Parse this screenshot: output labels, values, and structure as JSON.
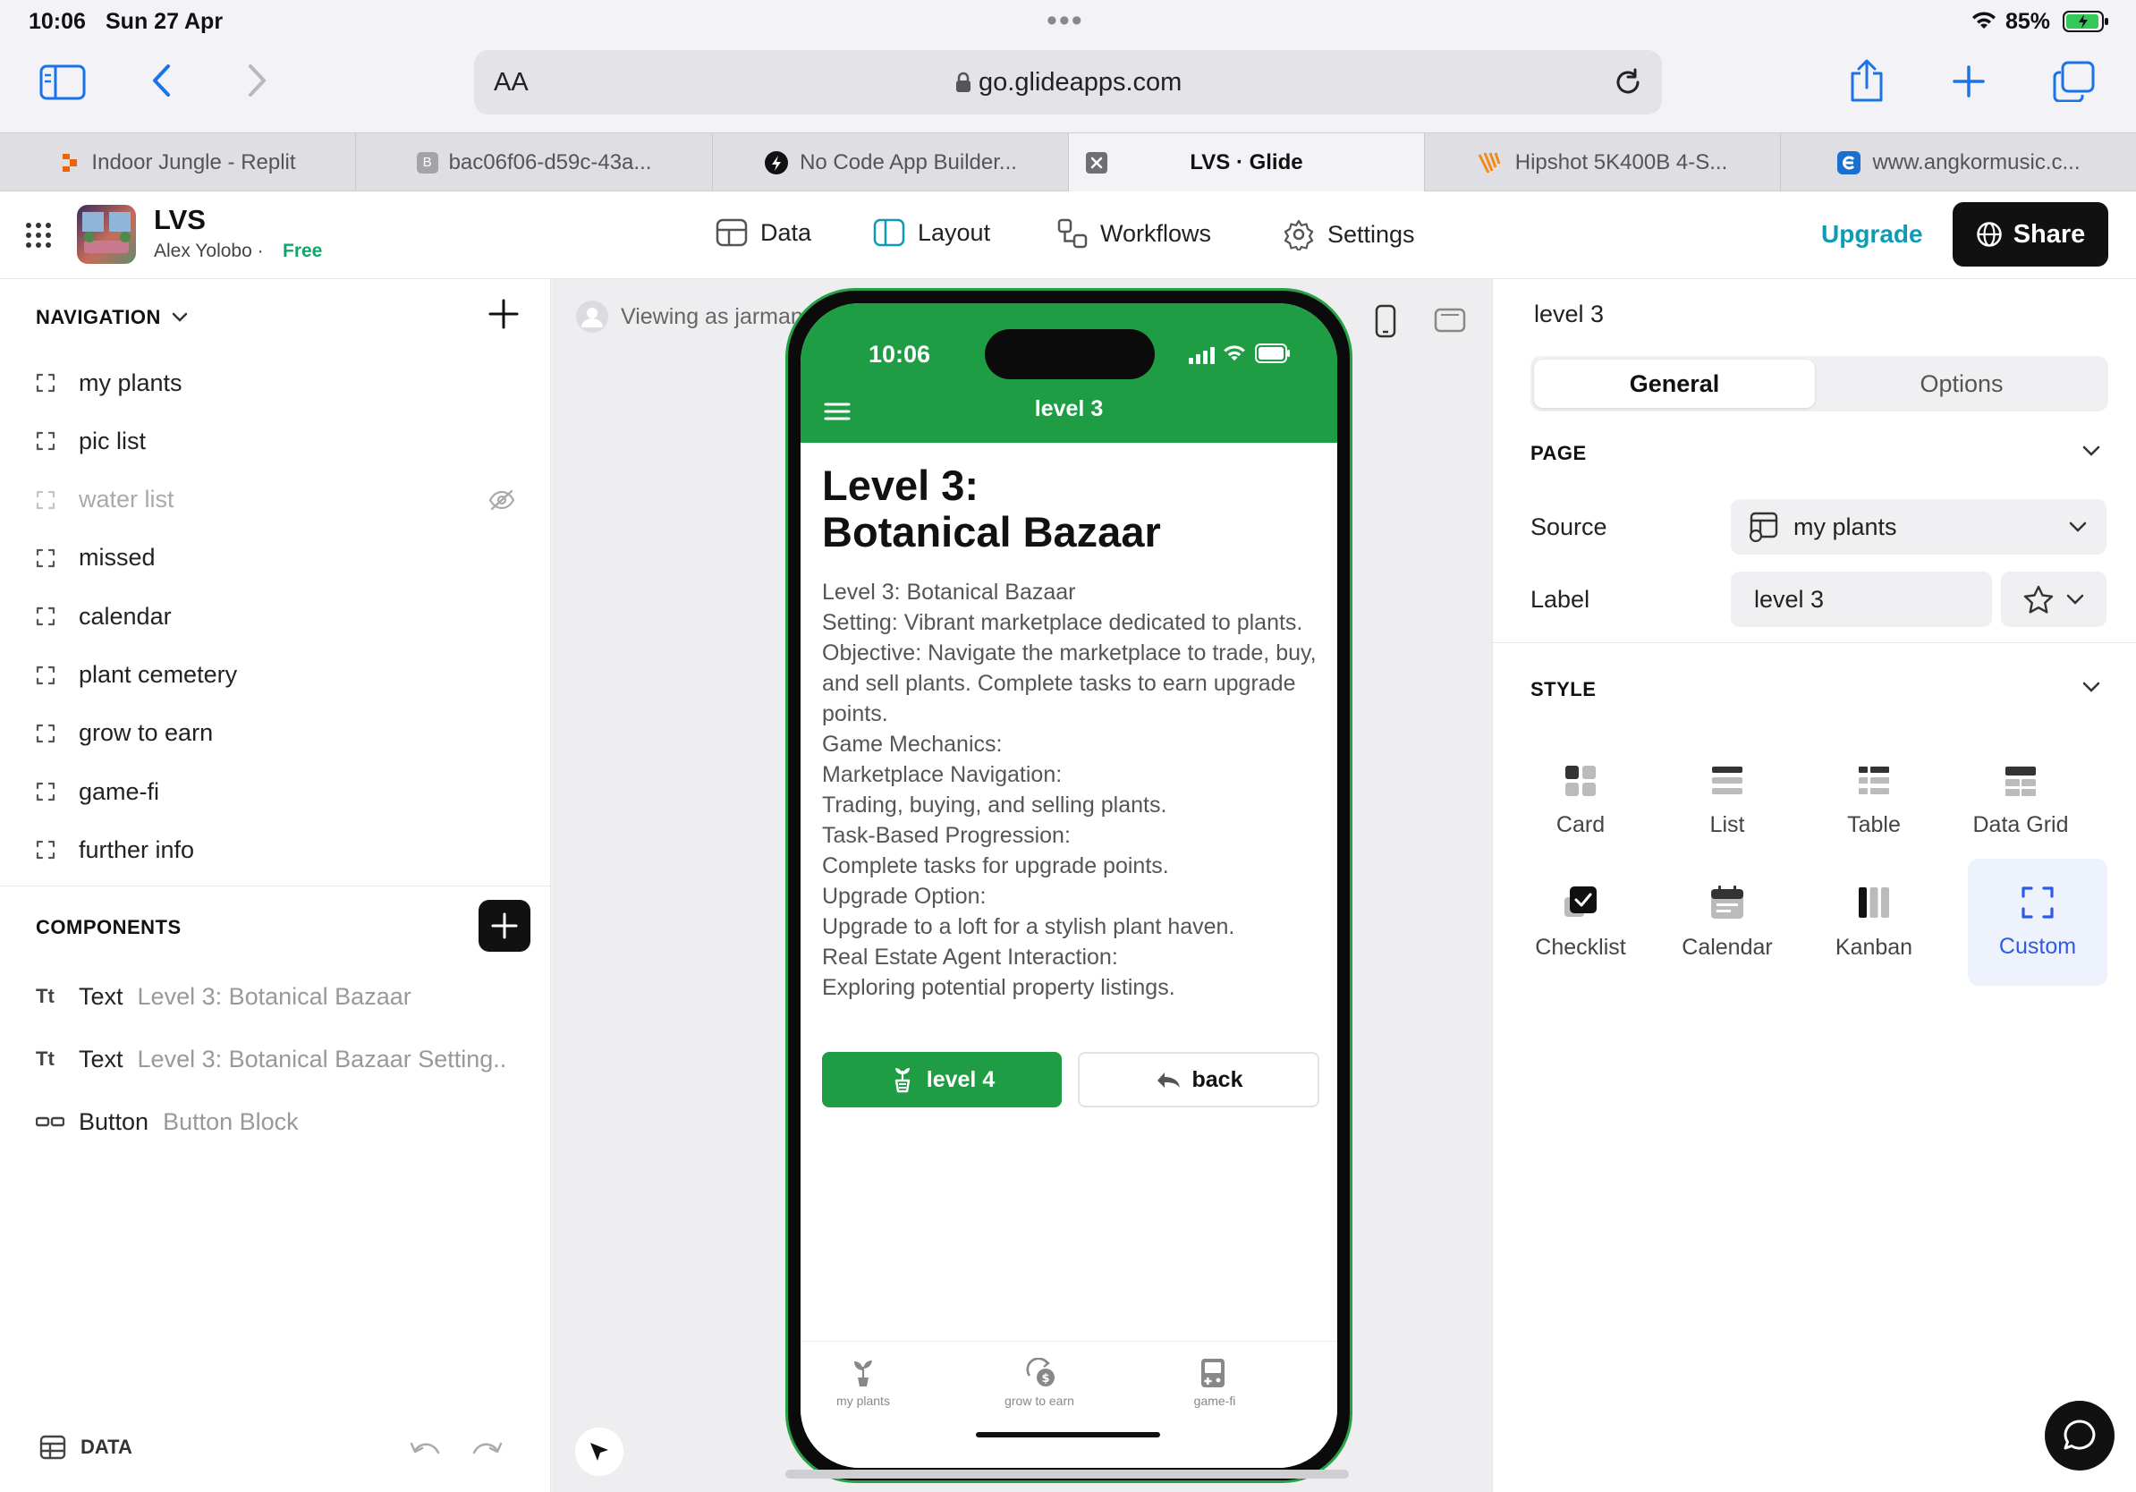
{
  "status_bar": {
    "time": "10:06",
    "date": "Sun 27 Apr",
    "battery": "85%"
  },
  "browser": {
    "url": "go.glideapps.com",
    "aa_label": "AA",
    "tabs": [
      {
        "label": "Indoor Jungle - Replit",
        "active": false
      },
      {
        "label": "bac06f06-d59c-43a...",
        "active": false
      },
      {
        "label": "No Code App Builder...",
        "active": false
      },
      {
        "label": "LVS · Glide",
        "active": true
      },
      {
        "label": "Hipshot 5K400B 4-S...",
        "active": false
      },
      {
        "label": "www.angkormusic.c...",
        "active": false
      }
    ]
  },
  "app_header": {
    "title": "LVS",
    "owner": "Alex Yolobo",
    "separator": "·",
    "plan": "Free",
    "tabs": [
      {
        "label": "Data",
        "icon": "table-icon"
      },
      {
        "label": "Layout",
        "icon": "layout-icon"
      },
      {
        "label": "Workflows",
        "icon": "workflow-icon"
      },
      {
        "label": "Settings",
        "icon": "gear-icon"
      }
    ],
    "upgrade_label": "Upgrade",
    "share_label": "Share"
  },
  "left_panel": {
    "navigation_title": "NAVIGATION",
    "nav_items": [
      {
        "label": "my plants",
        "hidden": false
      },
      {
        "label": "pic list",
        "hidden": false
      },
      {
        "label": "water list",
        "hidden": true
      },
      {
        "label": "missed",
        "hidden": false
      },
      {
        "label": "calendar",
        "hidden": false
      },
      {
        "label": "plant cemetery",
        "hidden": false
      },
      {
        "label": "grow to earn",
        "hidden": false
      },
      {
        "label": "game-fi",
        "hidden": false
      },
      {
        "label": "further info",
        "hidden": false
      }
    ],
    "components_title": "COMPONENTS",
    "components": [
      {
        "type_icon": "Tt",
        "name": "Text",
        "value": "Level 3: Botanical Bazaar"
      },
      {
        "type_icon": "Tt",
        "name": "Text",
        "value": "Level 3: Botanical Bazaar Setting.."
      },
      {
        "type_icon": "button-block-icon",
        "name": "Button",
        "value": "Button Block"
      }
    ],
    "footer_label": "DATA"
  },
  "canvas": {
    "viewing_as": "Viewing as jarmans"
  },
  "phone": {
    "time": "10:06",
    "screen_title": "level 3",
    "heading": "Level 3:\nBotanical Bazaar",
    "body_lines": [
      "Level 3: Botanical Bazaar",
      "Setting: Vibrant marketplace dedicated to plants.",
      "Objective: Navigate the marketplace to trade, buy, and sell plants. Complete tasks to earn upgrade points.",
      "Game Mechanics:",
      "Marketplace Navigation:",
      "Trading, buying, and selling plants.",
      "Task-Based Progression:",
      "Complete tasks for upgrade points.",
      "Upgrade Option:",
      "Upgrade to a loft for a stylish plant haven.",
      "Real Estate Agent Interaction:",
      "Exploring potential property listings."
    ],
    "btn_primary": "level 4",
    "btn_secondary": "back",
    "tab_bar": [
      {
        "label": "my plants",
        "icon": "plant-icon"
      },
      {
        "label": "grow to earn",
        "icon": "recycle-money-icon"
      },
      {
        "label": "game-fi",
        "icon": "game-device-icon"
      }
    ],
    "theme_color": "#1f9d45"
  },
  "right_panel": {
    "title": "level 3",
    "segments": [
      "General",
      "Options"
    ],
    "active_segment": "General",
    "page_section": "PAGE",
    "source_label": "Source",
    "source_value": "my plants",
    "label_label": "Label",
    "label_value": "level 3",
    "style_section": "STYLE",
    "styles": [
      {
        "label": "Card",
        "icon": "card-icon"
      },
      {
        "label": "List",
        "icon": "list-icon"
      },
      {
        "label": "Table",
        "icon": "table-icon"
      },
      {
        "label": "Data Grid",
        "icon": "data-grid-icon"
      },
      {
        "label": "Checklist",
        "icon": "checklist-icon"
      },
      {
        "label": "Calendar",
        "icon": "calendar-icon"
      },
      {
        "label": "Kanban",
        "icon": "kanban-icon"
      },
      {
        "label": "Custom",
        "icon": "custom-bracket-icon"
      }
    ],
    "selected_style": "Custom",
    "accent_color": "#2d5be3"
  }
}
